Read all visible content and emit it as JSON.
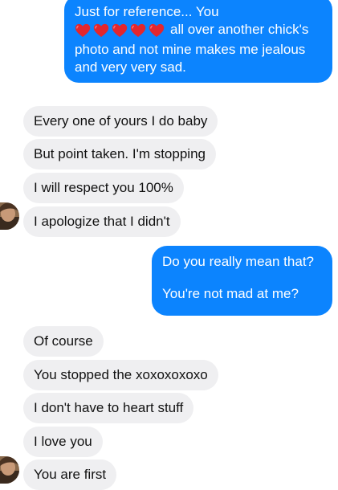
{
  "conversation": {
    "sent_first": {
      "line1": "Just for reference... You",
      "line2_suffix": "all over another chick's",
      "line3": "photo and not mine makes me jealous",
      "line4": "and very very sad.",
      "heart_count": 5
    },
    "received_group_1": [
      "Every one of yours I do baby",
      "But point taken. I'm stopping",
      "I will respect you 100%",
      "I apologize that I didn't"
    ],
    "sent_second": {
      "line1": "Do you really mean that?",
      "line2": "You're not mad at me?"
    },
    "received_group_2": [
      "Of course",
      "You stopped the xoxoxoxoxo",
      "I don't have to heart stuff",
      "I love you",
      "You are first"
    ]
  },
  "colors": {
    "sent_bubble": "#0c84fe",
    "received_bubble": "#efeff1",
    "heart": "#e3262e"
  }
}
